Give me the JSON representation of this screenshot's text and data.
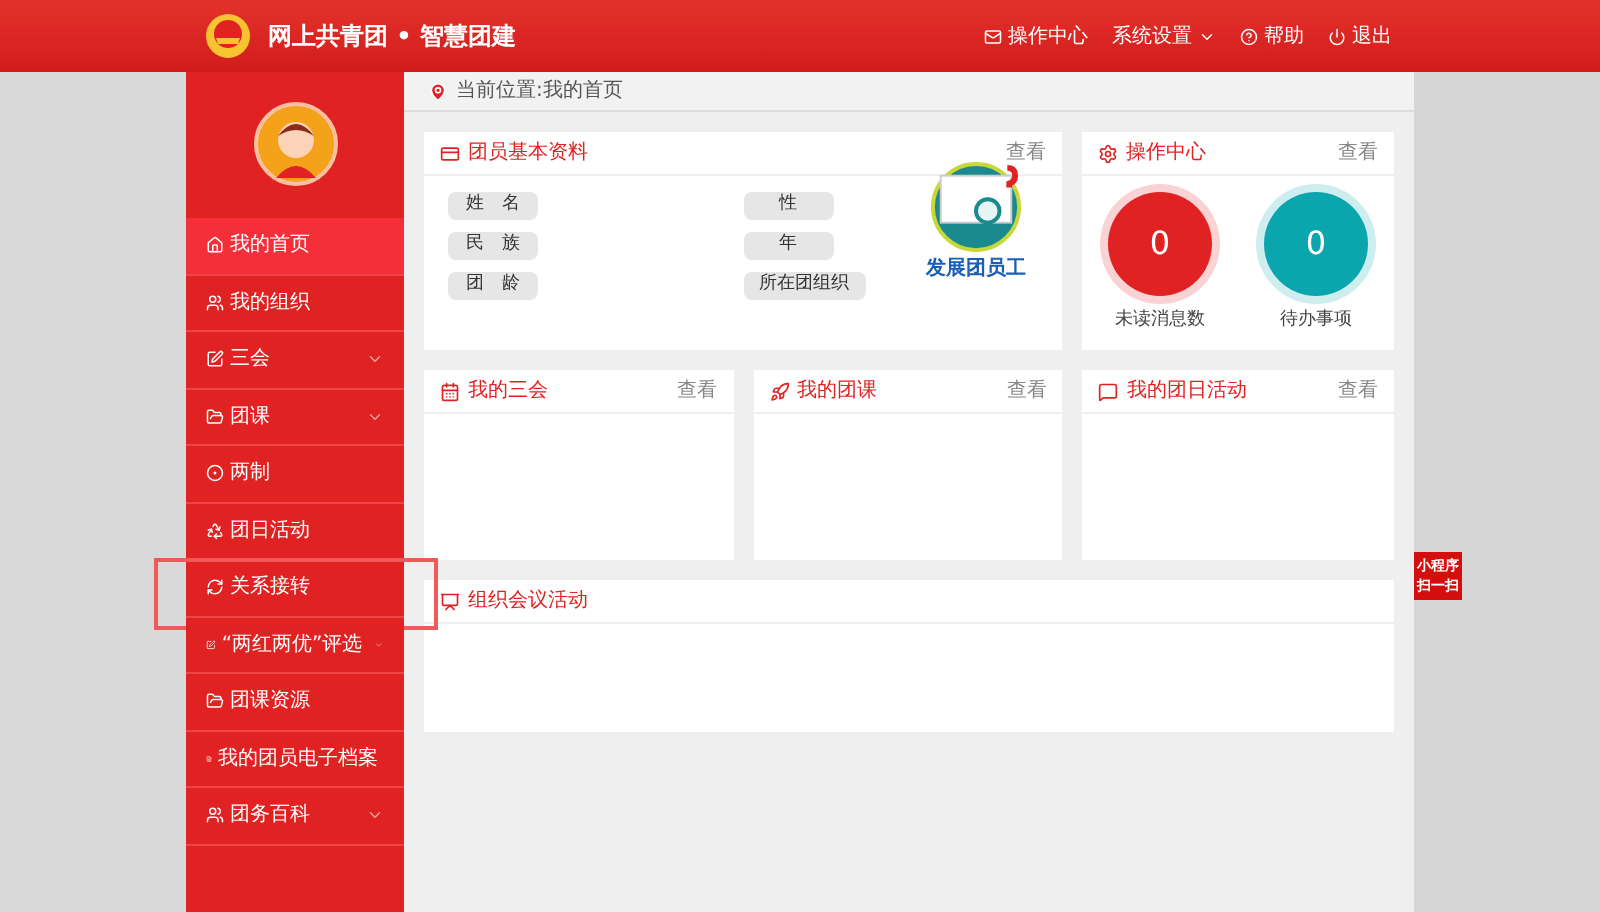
{
  "header": {
    "title": "网上共青团 • 智慧团建",
    "nav": [
      {
        "label": "操作中心",
        "dropdown": false
      },
      {
        "label": "系统设置",
        "dropdown": true
      },
      {
        "label": "帮助",
        "dropdown": false
      },
      {
        "label": "退出",
        "dropdown": false
      }
    ]
  },
  "sidebar": {
    "items": [
      {
        "label": "我的首页",
        "selected": true,
        "expandable": false,
        "highlighted": false
      },
      {
        "label": "我的组织",
        "selected": false,
        "expandable": false,
        "highlighted": false
      },
      {
        "label": "三会",
        "selected": false,
        "expandable": true,
        "highlighted": false
      },
      {
        "label": "团课",
        "selected": false,
        "expandable": true,
        "highlighted": false
      },
      {
        "label": "两制",
        "selected": false,
        "expandable": false,
        "highlighted": false
      },
      {
        "label": "团日活动",
        "selected": false,
        "expandable": false,
        "highlighted": false
      },
      {
        "label": "关系接转",
        "selected": false,
        "expandable": false,
        "highlighted": true
      },
      {
        "label": "“两红两优”评选",
        "selected": false,
        "expandable": true,
        "highlighted": false
      },
      {
        "label": "团课资源",
        "selected": false,
        "expandable": false,
        "highlighted": false
      },
      {
        "label": "我的团员电子档案",
        "selected": false,
        "expandable": false,
        "highlighted": false
      },
      {
        "label": "团务百科",
        "selected": false,
        "expandable": true,
        "highlighted": false
      }
    ]
  },
  "breadcrumb": "当前位置:我的首页",
  "profile_card": {
    "title": "团员基本资料",
    "action": "查看",
    "fields": [
      {
        "label": "姓　名"
      },
      {
        "label": "性"
      },
      {
        "label": "民　族"
      },
      {
        "label": "年"
      },
      {
        "label": "团　龄"
      },
      {
        "label": "所在团组织"
      }
    ],
    "promo": {
      "caption": "发展团员工"
    }
  },
  "ops_card": {
    "title": "操作中心",
    "action": "查看",
    "counters": [
      {
        "value": "0",
        "label": "未读消息数",
        "color": "#e02222"
      },
      {
        "value": "0",
        "label": "待办事项",
        "color": "#0aa5ad"
      }
    ]
  },
  "cards": [
    {
      "title": "我的三会",
      "action": "查看"
    },
    {
      "title": "我的团课",
      "action": "查看"
    },
    {
      "title": "我的团日活动",
      "action": "查看"
    }
  ],
  "meeting_card": {
    "title": "组织会议活动"
  },
  "side_tab": {
    "lines": [
      "小程序",
      "扫一扫"
    ]
  }
}
